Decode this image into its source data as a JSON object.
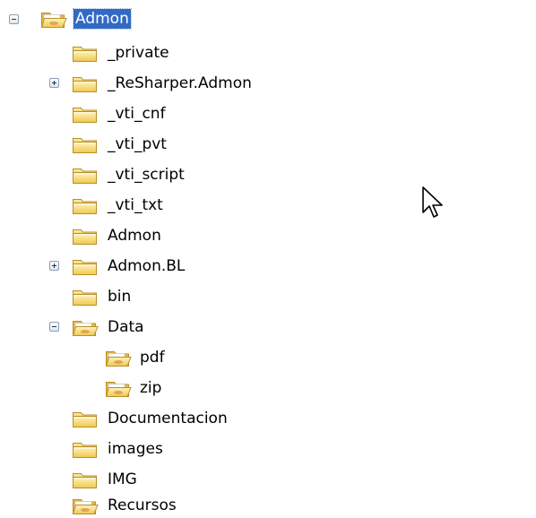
{
  "tree": {
    "root": {
      "label": "Admon",
      "state": "expanded",
      "selected": true,
      "icon": "open-folder-icon"
    },
    "items": [
      {
        "label": "_private",
        "icon": "folder-icon"
      },
      {
        "label": "_ReSharper.Admon",
        "icon": "folder-icon",
        "state": "collapsed"
      },
      {
        "label": "_vti_cnf",
        "icon": "folder-icon"
      },
      {
        "label": "_vti_pvt",
        "icon": "folder-icon"
      },
      {
        "label": "_vti_script",
        "icon": "folder-icon"
      },
      {
        "label": "_vti_txt",
        "icon": "folder-icon"
      },
      {
        "label": "Admon",
        "icon": "folder-icon"
      },
      {
        "label": "Admon.BL",
        "icon": "folder-icon",
        "state": "collapsed"
      },
      {
        "label": "bin",
        "icon": "folder-icon"
      },
      {
        "label": "Data",
        "icon": "open-folder-icon",
        "state": "expanded"
      },
      {
        "label": "pdf",
        "icon": "open-folder-icon"
      },
      {
        "label": "zip",
        "icon": "open-folder-icon"
      },
      {
        "label": "Documentacion",
        "icon": "folder-icon"
      },
      {
        "label": "images",
        "icon": "folder-icon"
      },
      {
        "label": "IMG",
        "icon": "folder-icon"
      },
      {
        "label": "Recursos",
        "icon": "open-folder-icon"
      }
    ]
  },
  "cursor": {
    "icon": "mouse-pointer-icon"
  },
  "colors": {
    "selection": "#316ac5",
    "folder_yellow": "#f5d773",
    "folder_outline": "#b88f2a"
  }
}
